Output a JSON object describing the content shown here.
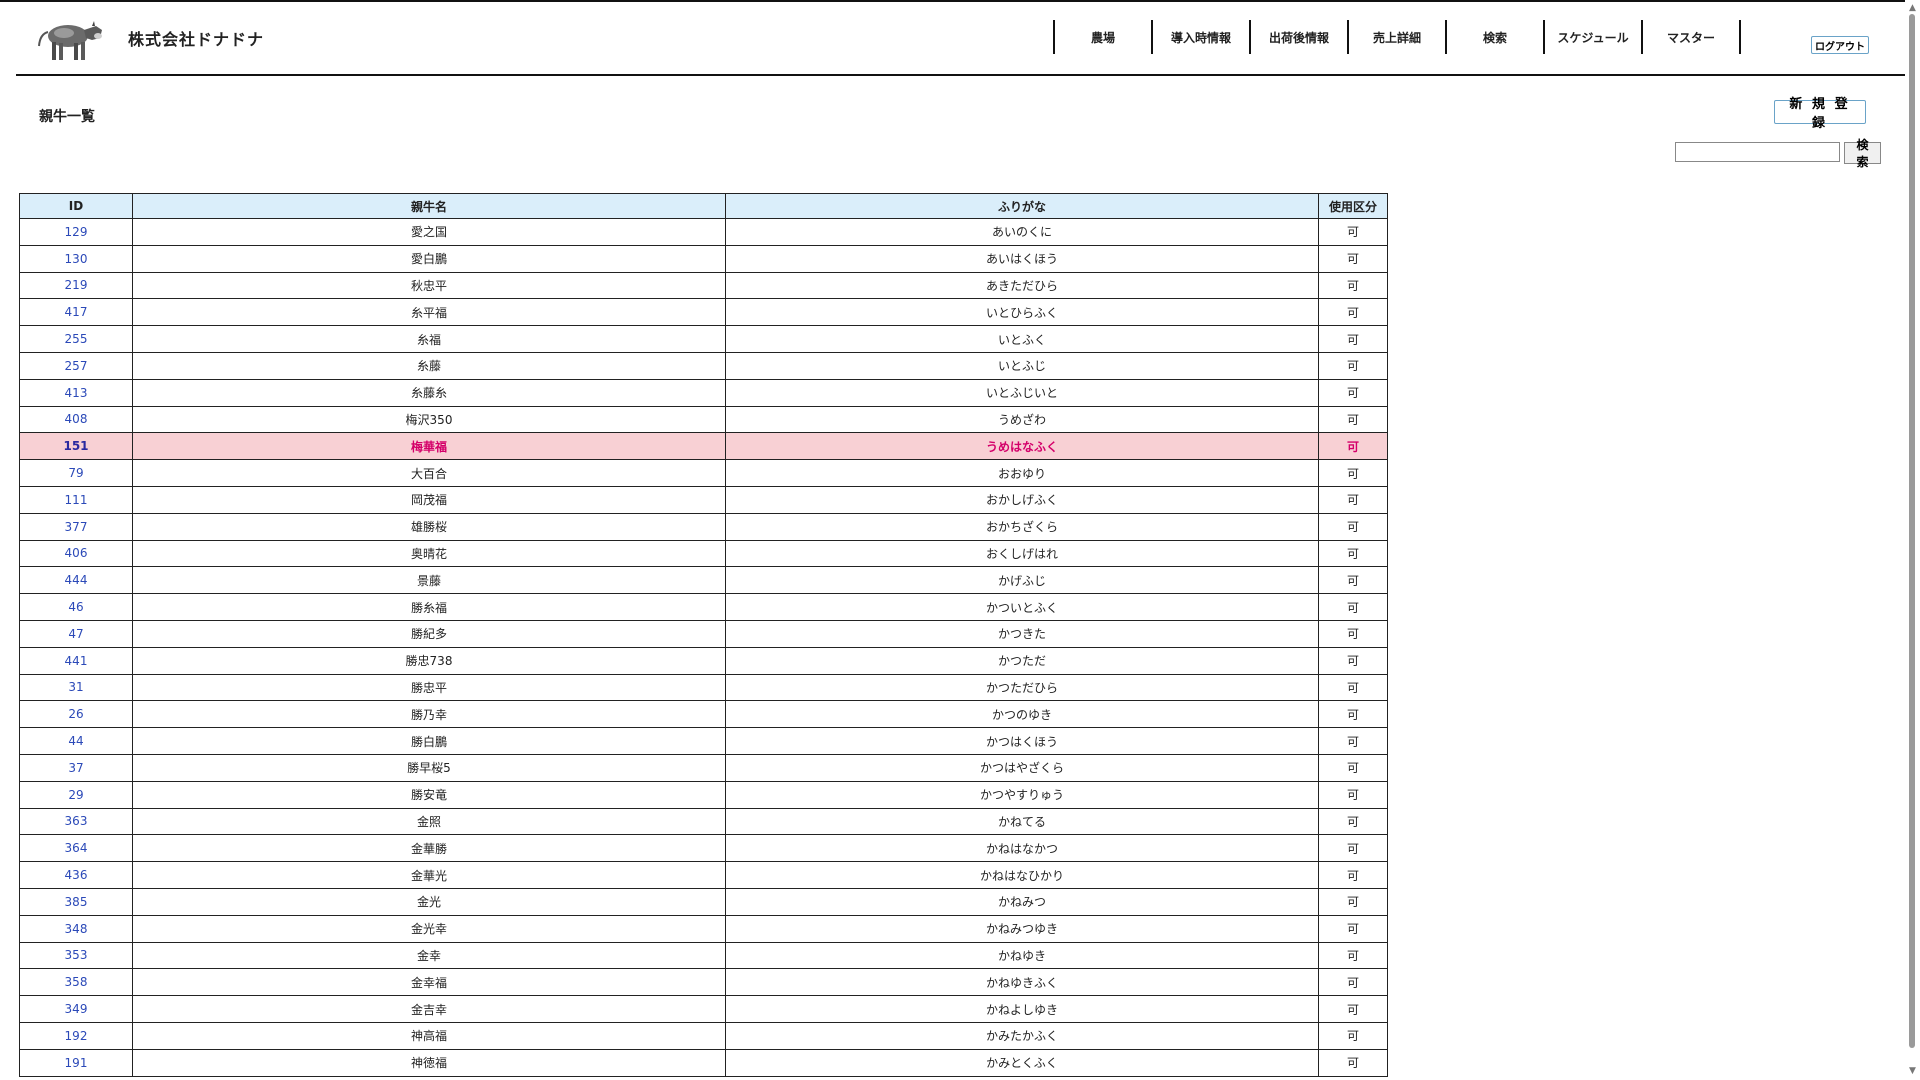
{
  "header": {
    "company_name": "株式会社ドナドナ",
    "nav": [
      "農場",
      "導入時情報",
      "出荷後情報",
      "売上詳細",
      "検索",
      "スケジュール",
      "マスター"
    ],
    "logout_label": "ログアウト"
  },
  "page": {
    "title": "親牛一覧",
    "new_button": "新 規 登 録",
    "search_placeholder": "",
    "search_button": "検索"
  },
  "table": {
    "headers": [
      "ID",
      "親牛名",
      "ふりがな",
      "使用区分"
    ],
    "rows": [
      [
        "129",
        "愛之国",
        "あいのくに",
        "可"
      ],
      [
        "130",
        "愛白鵬",
        "あいはくほう",
        "可"
      ],
      [
        "219",
        "秋忠平",
        "あきただひら",
        "可"
      ],
      [
        "417",
        "糸平福",
        "いとひらふく",
        "可"
      ],
      [
        "255",
        "糸福",
        "いとふく",
        "可"
      ],
      [
        "257",
        "糸藤",
        "いとふじ",
        "可"
      ],
      [
        "413",
        "糸藤糸",
        "いとふじいと",
        "可"
      ],
      [
        "408",
        "梅沢350",
        "うめざわ",
        "可"
      ],
      [
        "151",
        "梅華福",
        "うめはなふく",
        "可"
      ],
      [
        "79",
        "大百合",
        "おおゆり",
        "可"
      ],
      [
        "111",
        "岡茂福",
        "おかしげふく",
        "可"
      ],
      [
        "377",
        "雄勝桜",
        "おかちざくら",
        "可"
      ],
      [
        "406",
        "奥晴花",
        "おくしげはれ",
        "可"
      ],
      [
        "444",
        "景藤",
        "かげふじ",
        "可"
      ],
      [
        "46",
        "勝糸福",
        "かついとふく",
        "可"
      ],
      [
        "47",
        "勝紀多",
        "かつきた",
        "可"
      ],
      [
        "441",
        "勝忠738",
        "かつただ",
        "可"
      ],
      [
        "31",
        "勝忠平",
        "かつただひら",
        "可"
      ],
      [
        "26",
        "勝乃幸",
        "かつのゆき",
        "可"
      ],
      [
        "44",
        "勝白鵬",
        "かつはくほう",
        "可"
      ],
      [
        "37",
        "勝早桜5",
        "かつはやざくら",
        "可"
      ],
      [
        "29",
        "勝安竜",
        "かつやすりゅう",
        "可"
      ],
      [
        "363",
        "金照",
        "かねてる",
        "可"
      ],
      [
        "364",
        "金華勝",
        "かねはなかつ",
        "可"
      ],
      [
        "436",
        "金華光",
        "かねはなひかり",
        "可"
      ],
      [
        "385",
        "金光",
        "かねみつ",
        "可"
      ],
      [
        "348",
        "金光幸",
        "かねみつゆき",
        "可"
      ],
      [
        "353",
        "金幸",
        "かねゆき",
        "可"
      ],
      [
        "358",
        "金幸福",
        "かねゆきふく",
        "可"
      ],
      [
        "349",
        "金吉幸",
        "かねよしゆき",
        "可"
      ],
      [
        "192",
        "神高福",
        "かみたかふく",
        "可"
      ],
      [
        "191",
        "神徳福",
        "かみとくふく",
        "可"
      ]
    ],
    "highlighted_row_index": 8
  },
  "colors": {
    "header_bg": "#daeefa",
    "highlight_bg": "#f8d0d4",
    "highlight_text": "#d4006a",
    "id_link": "#2b49b8"
  },
  "icons": {
    "logo": "cow-logo-icon"
  }
}
